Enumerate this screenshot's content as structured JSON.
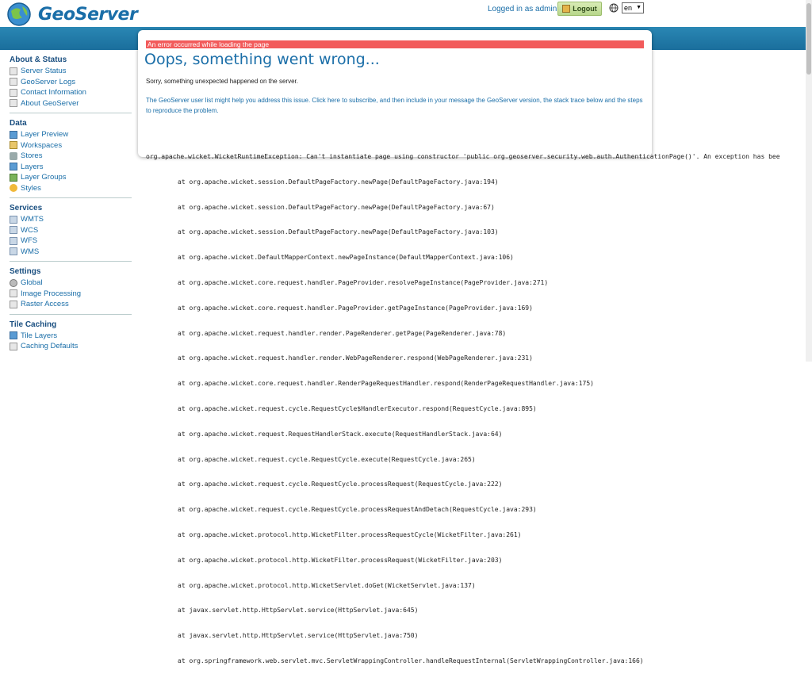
{
  "header": {
    "logo_text": "GeoServer",
    "login_text": "Logged in as admin.",
    "logout_label": "Logout",
    "language": "en"
  },
  "sidebar": {
    "sections": [
      {
        "title": "About & Status",
        "items": [
          "Server Status",
          "GeoServer Logs",
          "Contact Information",
          "About GeoServer"
        ]
      },
      {
        "title": "Data",
        "items": [
          "Layer Preview",
          "Workspaces",
          "Stores",
          "Layers",
          "Layer Groups",
          "Styles"
        ]
      },
      {
        "title": "Services",
        "items": [
          "WMTS",
          "WCS",
          "WFS",
          "WMS"
        ]
      },
      {
        "title": "Settings",
        "items": [
          "Global",
          "Image Processing",
          "Raster Access"
        ]
      },
      {
        "title": "Tile Caching",
        "items": [
          "Tile Layers",
          "Caching Defaults"
        ]
      }
    ]
  },
  "error": {
    "bar_text": "An error occurred while loading the page",
    "title": "Oops, something went wrong...",
    "sorry": "Sorry, something unexpected happened on the server.",
    "help": "The GeoServer user list might help you address this issue. Click here to subscribe, and then include in your message the GeoServer version, the stack trace below and the steps to reproduce the problem."
  },
  "trace": {
    "exception": "org.apache.wicket.WicketRuntimeException: Can't instantiate page using constructor 'public org.geoserver.security.web.auth.AuthenticationPage()'. An exception has bee",
    "lines": [
      "at org.apache.wicket.session.DefaultPageFactory.newPage(DefaultPageFactory.java:194)",
      "at org.apache.wicket.session.DefaultPageFactory.newPage(DefaultPageFactory.java:67)",
      "at org.apache.wicket.session.DefaultPageFactory.newPage(DefaultPageFactory.java:103)",
      "at org.apache.wicket.DefaultMapperContext.newPageInstance(DefaultMapperContext.java:106)",
      "at org.apache.wicket.core.request.handler.PageProvider.resolvePageInstance(PageProvider.java:271)",
      "at org.apache.wicket.core.request.handler.PageProvider.getPageInstance(PageProvider.java:169)",
      "at org.apache.wicket.request.handler.render.PageRenderer.getPage(PageRenderer.java:78)",
      "at org.apache.wicket.request.handler.render.WebPageRenderer.respond(WebPageRenderer.java:231)",
      "at org.apache.wicket.core.request.handler.RenderPageRequestHandler.respond(RenderPageRequestHandler.java:175)",
      "at org.apache.wicket.request.cycle.RequestCycle$HandlerExecutor.respond(RequestCycle.java:895)",
      "at org.apache.wicket.request.RequestHandlerStack.execute(RequestHandlerStack.java:64)",
      "at org.apache.wicket.request.cycle.RequestCycle.execute(RequestCycle.java:265)",
      "at org.apache.wicket.request.cycle.RequestCycle.processRequest(RequestCycle.java:222)",
      "at org.apache.wicket.request.cycle.RequestCycle.processRequestAndDetach(RequestCycle.java:293)",
      "at org.apache.wicket.protocol.http.WicketFilter.processRequestCycle(WicketFilter.java:261)",
      "at org.apache.wicket.protocol.http.WicketFilter.processRequest(WicketFilter.java:203)",
      "at org.apache.wicket.protocol.http.WicketServlet.doGet(WicketServlet.java:137)",
      "at javax.servlet.http.HttpServlet.service(HttpServlet.java:645)",
      "at javax.servlet.http.HttpServlet.service(HttpServlet.java:750)",
      "at org.springframework.web.servlet.mvc.ServletWrappingController.handleRequestInternal(ServletWrappingController.java:166)"
    ]
  },
  "colors": {
    "brand_blue": "#1a6ea8",
    "band_blue": "#1f78a8",
    "error_red": "#f25b5b"
  }
}
